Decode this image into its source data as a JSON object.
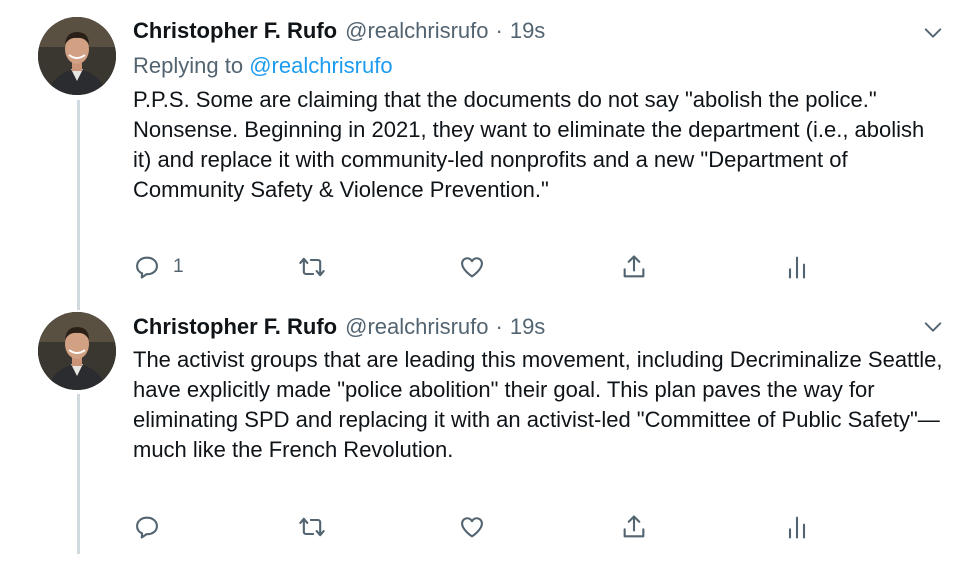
{
  "tweets": [
    {
      "author_name": "Christopher F. Rufo",
      "handle": "@realchrisrufo",
      "separator": "·",
      "time": "19s",
      "replying_prefix": "Replying to",
      "replying_to": "@realchrisrufo",
      "text": "P.P.S. Some are claiming that the documents do not say \"abolish the police.\" Nonsense. Beginning in 2021, they want to eliminate the department (i.e., abolish it) and replace it with community-led nonprofits and a new \"Department of Community Safety & Violence Prevention.\"",
      "reply_count": "1",
      "icons": [
        "reply-icon",
        "retweet-icon",
        "like-icon",
        "share-icon",
        "analytics-icon"
      ]
    },
    {
      "author_name": "Christopher F. Rufo",
      "handle": "@realchrisrufo",
      "separator": "·",
      "time": "19s",
      "text": "The activist groups that are leading this movement, including Decriminalize Seattle, have explicitly made \"police abolition\" their goal. This plan paves the way for eliminating SPD and replacing it with an activist-led \"Committee of Public Safety\"—much like the French Revolution.",
      "reply_count": "",
      "icons": [
        "reply-icon",
        "retweet-icon",
        "like-icon",
        "share-icon",
        "analytics-icon"
      ]
    }
  ],
  "colors": {
    "text_primary": "#0f1419",
    "text_secondary": "#536471",
    "link": "#1d9bf0",
    "thread_line": "#cfd9de"
  }
}
